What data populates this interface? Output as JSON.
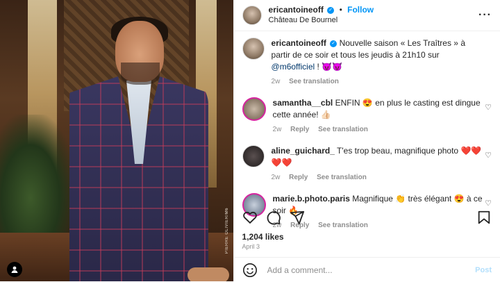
{
  "post": {
    "author": "ericantoineoff",
    "location": "Château De Bournel",
    "follow_label": "Follow",
    "more_label": "···",
    "photo_credit": "PIERRE OLIVIER/M6"
  },
  "caption": {
    "author": "ericantoineoff",
    "text_before": "Nouvelle saison « Les Traîtres » à partir de ce soir et tous les jeudis à 21h10 sur ",
    "mention": "@m6officiel",
    "text_after": " ! 😈😈",
    "time": "2w",
    "translate": "See translation"
  },
  "comments": [
    {
      "author": "samantha__cbl",
      "text": "ENFIN 😍 en plus le casting est dingue cette année! 👍🏻",
      "time": "2w",
      "reply": "Reply",
      "translate": "See translation"
    },
    {
      "author": "aline_guichard_",
      "text": "T'es trop beau, magnifique photo ❤️❤️❤️❤️",
      "time": "2w",
      "reply": "Reply",
      "translate": "See translation"
    },
    {
      "author": "marie.b.photo.paris",
      "text": "Magnifique 👏 très élégant 😍 à ce soir 🔥",
      "time": "2w",
      "reply": "Reply",
      "translate": "See translation"
    }
  ],
  "stats": {
    "likes": "1,204 likes",
    "date": "April 3"
  },
  "composer": {
    "placeholder": "Add a comment...",
    "post_label": "Post"
  },
  "colors": {
    "accent": "#0095f6",
    "link": "#00376b",
    "muted": "#8e8e8e"
  }
}
